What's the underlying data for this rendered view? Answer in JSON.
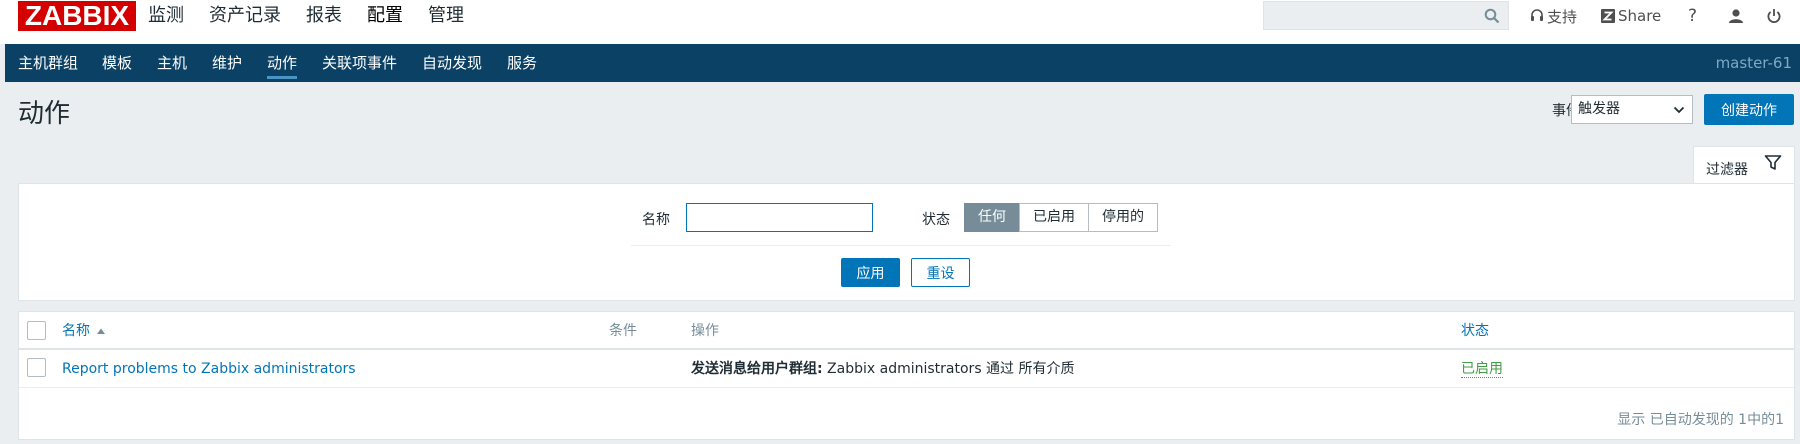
{
  "header": {
    "logo": "ZABBIX",
    "menu": [
      {
        "label": "监测",
        "active": false
      },
      {
        "label": "资产记录",
        "active": false
      },
      {
        "label": "报表",
        "active": false
      },
      {
        "label": "配置",
        "active": true
      },
      {
        "label": "管理",
        "active": false
      }
    ],
    "search": {
      "value": "",
      "placeholder": ""
    },
    "support_label": "支持",
    "share_label": "Share",
    "help_label": "?"
  },
  "subnav": {
    "items": [
      {
        "label": "主机群组",
        "active": false
      },
      {
        "label": "模板",
        "active": false
      },
      {
        "label": "主机",
        "active": false
      },
      {
        "label": "维护",
        "active": false
      },
      {
        "label": "动作",
        "active": true
      },
      {
        "label": "关联项事件",
        "active": false
      },
      {
        "label": "自动发现",
        "active": false
      },
      {
        "label": "服务",
        "active": false
      }
    ],
    "server_name": "master-61"
  },
  "page": {
    "title": "动作",
    "event_source_label": "事件源",
    "event_source_value": "触发器",
    "create_button": "创建动作"
  },
  "filter": {
    "tab_label": "过滤器",
    "name_label": "名称",
    "name_value": "",
    "status_label": "状态",
    "status_options": [
      "任何",
      "已启用",
      "停用的"
    ],
    "status_selected": "任何",
    "apply_button": "应用",
    "reset_button": "重设"
  },
  "table": {
    "columns": {
      "name": "名称",
      "conditions": "条件",
      "operations": "操作",
      "status": "状态"
    },
    "sort": {
      "column": "名称",
      "direction": "asc"
    },
    "rows": [
      {
        "name": "Report problems to Zabbix administrators",
        "conditions": "",
        "operation_bold": "发送消息给用户群组:",
        "operation_text": " Zabbix administrators 通过 所有介质",
        "status": "已启用"
      }
    ],
    "footer": "显示 已自动发现的 1中的1"
  },
  "colors": {
    "brand": "#d40000",
    "nav_bg": "#0b4165",
    "accent": "#0275b8",
    "enabled": "#429e47",
    "page_bg": "#ebeef0"
  }
}
